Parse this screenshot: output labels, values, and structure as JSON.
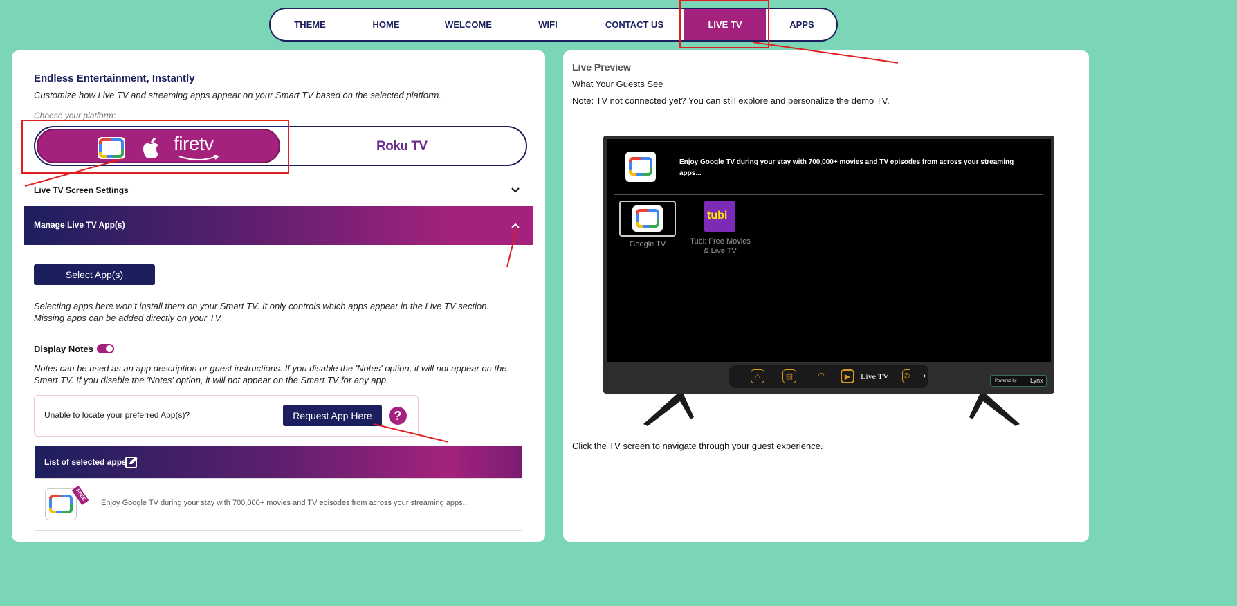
{
  "nav": {
    "tabs": [
      {
        "label": "THEME"
      },
      {
        "label": "HOME"
      },
      {
        "label": "WELCOME"
      },
      {
        "label": "WIFI"
      },
      {
        "label": "CONTACT US"
      },
      {
        "label": "LIVE TV",
        "active": true
      },
      {
        "label": "APPS"
      }
    ]
  },
  "left": {
    "title": "Endless Entertainment, Instantly",
    "subtitle": "Customize how Live TV and streaming apps appear on your Smart TV based on the selected platform.",
    "platform_label": "Choose your platform:",
    "platform_active_logos": "firetv",
    "platform_other": "Roku TV",
    "screen_settings": "Live TV Screen Settings",
    "manage_apps": "Manage Live TV App(s)",
    "select_apps_button": "Select App(s)",
    "select_note": "Selecting apps here won’t install them on your Smart TV. It only controls which apps appear in the Live TV section. Missing apps can be added directly on your TV.",
    "display_notes": "Display Notes",
    "notes_desc": "Notes can be used as an app description or guest instructions. If you disable the 'Notes' option, it will not appear on the Smart TV. If you disable the 'Notes' option, it will not appear on the Smart TV for any app.",
    "unable_text": "Unable to locate your preferred App(s)?",
    "request_button": "Request App Here",
    "help_symbol": "?",
    "list_title": "List of selected apps",
    "list_items": [
      {
        "badge": "FREE",
        "description": "Enjoy Google TV during your stay with 700,000+ movies and TV episodes from across your streaming apps..."
      }
    ]
  },
  "right": {
    "title": "Live Preview",
    "subtitle": "What Your Guests See",
    "note": "Note: TV not connected yet? You can still explore and personalize the demo TV.",
    "footer": "Click the TV screen to navigate through your guest experience."
  },
  "tv": {
    "header_text": "Enjoy Google TV during your stay with 700,000+ movies and TV episodes from across your streaming apps...",
    "apps": [
      {
        "label": "Google TV"
      },
      {
        "label": "Tubi: Free Movies & Live TV",
        "logo_text": "tubi"
      }
    ],
    "dock_label": "Live TV",
    "dock_more": "›",
    "powered_by": "Powered by",
    "powered_brand": "Lynx"
  },
  "colors": {
    "navy": "#1c1f5e",
    "magenta": "#a4227d",
    "background": "#7ad6b6",
    "annotation": "#e02020"
  }
}
